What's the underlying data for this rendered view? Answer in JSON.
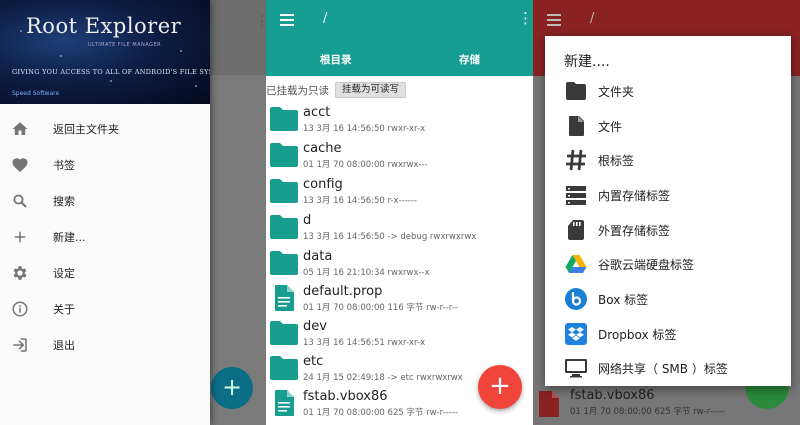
{
  "drawer_panel": {
    "header": {
      "app_name": "Root Explorer",
      "subtitle": "ULTIMATE FILE MANAGER",
      "tagline": "GIVING YOU ACCESS TO ALL OF ANDROID'S FILE SYSTEM",
      "brand": "Speed Software"
    },
    "menu": [
      {
        "label": "返回主文件夹",
        "icon": "home-icon"
      },
      {
        "label": "书签",
        "icon": "heart-icon"
      },
      {
        "label": "搜索",
        "icon": "search-icon"
      },
      {
        "label": "新建...",
        "icon": "plus-icon"
      },
      {
        "label": "设定",
        "icon": "gear-icon"
      },
      {
        "label": "关于",
        "icon": "info-icon"
      },
      {
        "label": "退出",
        "icon": "exit-icon"
      }
    ],
    "fab_symbol": "+"
  },
  "file_panel": {
    "path": "/",
    "tabs": [
      "根目录",
      "存储"
    ],
    "mount_status": "已挂载为只读",
    "mount_button": "挂载为可读写",
    "files": [
      {
        "name": "acct",
        "meta": "13 3月 16 14:56:50   rwxr-xr-x",
        "type": "folder"
      },
      {
        "name": "cache",
        "meta": "01 1月 70 08:00:00   rwxrwx---",
        "type": "folder"
      },
      {
        "name": "config",
        "meta": "13 3月 16 14:56:50   r-x------",
        "type": "folder"
      },
      {
        "name": "d",
        "meta": "13 3月 16 14:56:50  -> debug  rwxrwxrwx",
        "type": "folder"
      },
      {
        "name": "data",
        "meta": "05 1月 16 21:10:34   rwxrwx--x",
        "type": "folder"
      },
      {
        "name": "default.prop",
        "meta": "01 1月 70 08:00:00  116 字节  rw-r--r--",
        "type": "file"
      },
      {
        "name": "dev",
        "meta": "13 3月 16 14:56:51   rwxr-xr-x",
        "type": "folder"
      },
      {
        "name": "etc",
        "meta": "24 1月 15 02:49:18  -> etc  rwxrwxrwx",
        "type": "folder"
      },
      {
        "name": "fstab.vbox86",
        "meta": "01 1月 70 08:00:00  625 字节  rw-r-----",
        "type": "file"
      }
    ],
    "fab_symbol": "+"
  },
  "create_panel": {
    "path": "/",
    "dialog_title": "新建....",
    "items": [
      {
        "label": "文件夹",
        "icon": "folder-icon"
      },
      {
        "label": "文件",
        "icon": "file-icon"
      },
      {
        "label": "根标签",
        "icon": "hash-icon"
      },
      {
        "label": "内置存储标签",
        "icon": "storage-icon"
      },
      {
        "label": "外置存储标签",
        "icon": "sd-card-icon"
      },
      {
        "label": "谷歌云端硬盘标签",
        "icon": "google-drive-icon"
      },
      {
        "label": "Box 标签",
        "icon": "box-icon"
      },
      {
        "label": "Dropbox 标签",
        "icon": "dropbox-icon"
      },
      {
        "label": "网络共享（ SMB ）标签",
        "icon": "monitor-icon"
      }
    ],
    "behind_file": {
      "name": "fstab.vbox86",
      "meta": "01 1月 70 08:00:00  625 字节  rw-r-----"
    }
  },
  "colors": {
    "teal_accent": "#169e92",
    "folder": "#179e8e",
    "fab_red": "#f1453b",
    "drawer_bg": "#fafafa"
  }
}
